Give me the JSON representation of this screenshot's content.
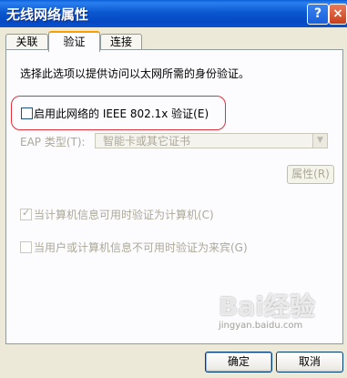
{
  "window": {
    "title": "无线网络属性",
    "help_label": "?",
    "close_label": "×"
  },
  "tabs": [
    {
      "label": "关联"
    },
    {
      "label": "验证"
    },
    {
      "label": "连接"
    }
  ],
  "auth": {
    "description": "选择此选项以提供访问以太网所需的身份验证。",
    "enable_8021x_label": "启用此网络的 IEEE 802.1x 验证(E)",
    "eap_type_label": "EAP 类型(T):",
    "eap_type_value": "智能卡或其它证书",
    "properties_label": "属性(R)",
    "computer_auth_label": "当计算机信息可用时验证为计算机(C)",
    "guest_auth_label": "当用户或计算机信息不可用时验证为来宾(G)"
  },
  "buttons": {
    "ok_label": "确定",
    "cancel_label": "取消"
  },
  "watermark": {
    "text": "Bai经验",
    "sub": "jingyan.baidu.com"
  }
}
